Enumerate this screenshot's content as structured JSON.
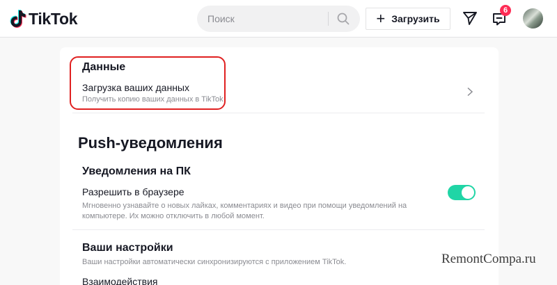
{
  "header": {
    "logo_text": "TikTok",
    "search_placeholder": "Поиск",
    "upload_label": "Загрузить",
    "upload_icon": "plus-icon",
    "inbox_badge": "6"
  },
  "data_section": {
    "title": "Данные",
    "item_title": "Загрузка ваших данных",
    "item_subtitle": "Получить копию ваших данных в TikTok"
  },
  "push": {
    "title": "Push-уведомления",
    "pc_title": "Уведомления на ПК",
    "browser_label": "Разрешить в браузере",
    "browser_desc_line1": "Мгновенно узнавайте о новых лайках, комментариях и видео при помощи уведомлений на",
    "browser_desc_line2": "компьютере. Их можно отключить в любой момент.",
    "browser_enabled": true
  },
  "settings": {
    "title": "Ваши настройки",
    "subtitle": "Ваши настройки автоматически синхронизируются с приложением TikTok.",
    "next_item": "Взаимодействия"
  },
  "colors": {
    "accent_toggle": "#20d5a6",
    "badge": "#fe2c55",
    "highlight_border": "#e02020"
  },
  "watermark": "RemontCompa.ru"
}
